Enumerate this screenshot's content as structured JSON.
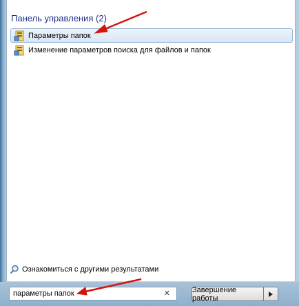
{
  "start_menu": {
    "section_title": "Панель управления (2)",
    "results": [
      {
        "label": "Параметры папок",
        "icon": "folder-options-icon",
        "selected": true
      },
      {
        "label": "Изменение параметров поиска для файлов и папок",
        "icon": "folder-options-icon",
        "selected": false
      }
    ],
    "more_results_label": "Ознакомиться с другими результатами",
    "search": {
      "value": "параметры папок",
      "clear_glyph": "✕"
    },
    "shutdown_label": "Завершение работы"
  },
  "colors": {
    "section_title": "#1e3287",
    "annotation_arrow": "#d2140c",
    "selection_border": "#98b6d6"
  }
}
